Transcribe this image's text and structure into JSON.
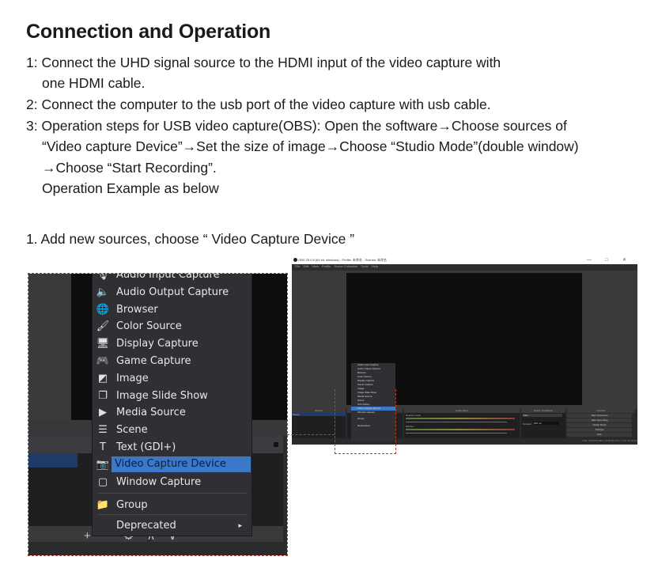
{
  "heading": "Connection and Operation",
  "steps": [
    {
      "line1": "1: Connect the UHD signal source to the HDMI input of the video capture with",
      "line2": "one HDMI cable."
    },
    {
      "line1": "2: Connect the computer to the usb port of the video capture with usb cable."
    },
    {
      "line1": "3: Operation steps for USB video capture(OBS): Open the software→Choose sources of",
      "line2": "“Video capture Device”→Set the size of image→Choose “Studio Mode”(double window)",
      "line3": "→Choose “Start Recording”.",
      "line4": "Operation Example as below"
    }
  ],
  "example_caption": "1. Add new sources, choose “ Video Capture Device ”",
  "left_screenshot": {
    "menu_items": [
      {
        "icon": "microphone-icon",
        "glyph": "🎙",
        "label": "Audio Input Capture"
      },
      {
        "icon": "speaker-icon",
        "glyph": "🔈",
        "label": "Audio Output Capture"
      },
      {
        "icon": "globe-icon",
        "glyph": "🌐",
        "label": "Browser"
      },
      {
        "icon": "brush-icon",
        "glyph": "🖌",
        "label": "Color Source"
      },
      {
        "icon": "monitor-icon",
        "glyph": "🖥",
        "label": "Display Capture"
      },
      {
        "icon": "gamepad-icon",
        "glyph": "🎮",
        "label": "Game Capture"
      },
      {
        "icon": "image-icon",
        "glyph": "◩",
        "label": "Image"
      },
      {
        "icon": "slideshow-icon",
        "glyph": "❐",
        "label": "Image Slide Show"
      },
      {
        "icon": "play-icon",
        "glyph": "▶",
        "label": "Media Source"
      },
      {
        "icon": "list-icon",
        "glyph": "☰",
        "label": "Scene"
      },
      {
        "icon": "text-icon",
        "glyph": "T",
        "label": "Text (GDI+)"
      },
      {
        "icon": "camera-icon",
        "glyph": "📷",
        "label": "Video Capture Device",
        "selected": true
      },
      {
        "icon": "window-icon",
        "glyph": "▢",
        "label": "Window Capture"
      }
    ],
    "group_item": {
      "icon": "folder-icon",
      "glyph": "📁",
      "label": "Group"
    },
    "submenu_item": {
      "label": "Deprecated",
      "chevron": "▸"
    },
    "dock_toolbar": "+ − ⚙ ∧ ∨",
    "accent_color": "#3c78c8"
  },
  "right_screenshot": {
    "window_title": "OBS 25.0.8 (64 bit, windows) - Profile: 未命名 - Scenes: 未命名",
    "window_controls": "— □ ✕",
    "menubar": [
      "File",
      "Edit",
      "View",
      "Profile",
      "Scene Collection",
      "Tools",
      "Help"
    ],
    "docks": [
      "Scenes",
      "Sources",
      "Audio Mixer",
      "Scene Transitions",
      "Controls"
    ],
    "scene_item": "Scene",
    "mixer_tracks": [
      "Desktop Audio",
      "Mic/Aux"
    ],
    "transition": "Fade",
    "duration_label": "Duration",
    "duration_value": "300 ms",
    "controls": [
      "Start Streaming",
      "Start Recording",
      "Studio Mode",
      "Settings",
      "Exit"
    ],
    "status": "LIVE: 00:00:00   REC: 00:00:00   CPU: 1.0%, 30.00 fps",
    "menu_items": [
      "Audio Input Capture",
      "Audio Output Capture",
      "Browser",
      "Color Source",
      "Display Capture",
      "Game Capture",
      "Image",
      "Image Slide Show",
      "Media Source",
      "Scene",
      "Text (GDI+)",
      "Video Capture Device",
      "Window Capture",
      "Group",
      "Deprecated"
    ],
    "selected_index": 11
  }
}
